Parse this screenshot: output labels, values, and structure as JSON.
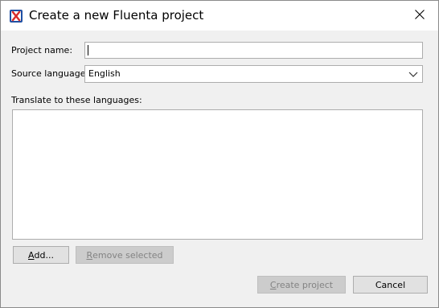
{
  "window": {
    "title": "Create a new Fluenta project",
    "app_icon": "fluenta-app-icon",
    "close_icon": "close-icon"
  },
  "form": {
    "project_name_label": "Project name:",
    "project_name_value": "",
    "source_language_label": "Source language:",
    "source_language_value": "English",
    "dropdown_icon": "chevron-down-icon",
    "translate_label": "Translate to these languages:",
    "target_languages": []
  },
  "buttons": {
    "add_mnemonic": "A",
    "add_rest": "dd...",
    "remove_mnemonic": "R",
    "remove_rest": "emove selected",
    "create_mnemonic": "C",
    "create_rest": "reate project",
    "cancel": "Cancel"
  },
  "colors": {
    "icon_blue": "#1e4fa3",
    "icon_red": "#d92b2b",
    "disabled_text": "#838383"
  }
}
